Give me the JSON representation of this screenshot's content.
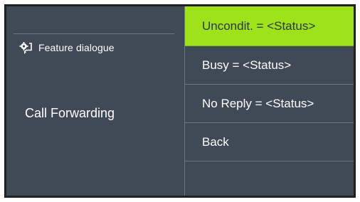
{
  "left_panel": {
    "feature_label": "Feature dialogue",
    "feature_icon": "chat-gear-icon",
    "title": "Call Forwarding"
  },
  "menu": {
    "items": [
      {
        "label": "Uncondit. = <Status>",
        "selected": true
      },
      {
        "label": "Busy = <Status>",
        "selected": false
      },
      {
        "label": "No Reply = <Status>",
        "selected": false
      },
      {
        "label": "Back",
        "selected": false
      },
      {
        "label": "",
        "selected": false
      }
    ]
  },
  "colors": {
    "screen_bg": "#3f4a56",
    "highlight": "#9ee21a",
    "divider": "#6c7781",
    "bezel": "#222222"
  }
}
